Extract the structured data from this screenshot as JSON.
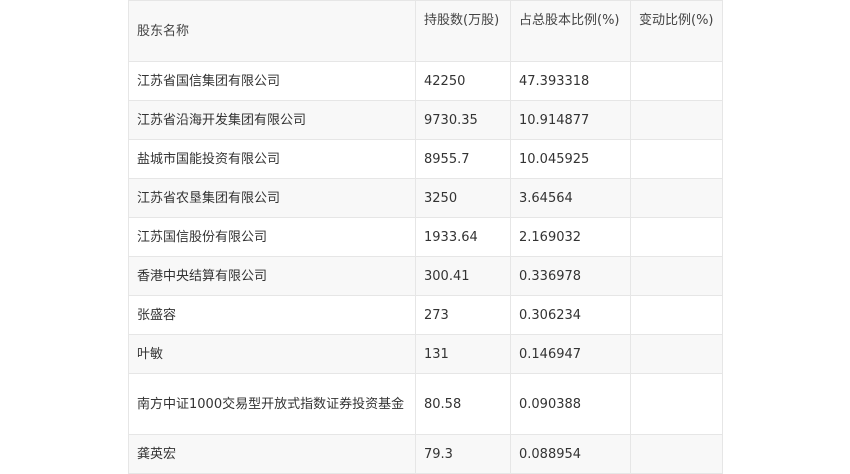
{
  "table": {
    "headers": {
      "name": "股东名称",
      "shares": "持股数(万股)",
      "ratio": "占总股本比例(%)",
      "change": "变动比例(%)"
    },
    "rows": [
      {
        "name": "江苏省国信集团有限公司",
        "shares": "42250",
        "ratio": "47.393318",
        "change": ""
      },
      {
        "name": "江苏省沿海开发集团有限公司",
        "shares": "9730.35",
        "ratio": "10.914877",
        "change": ""
      },
      {
        "name": "盐城市国能投资有限公司",
        "shares": "8955.7",
        "ratio": "10.045925",
        "change": ""
      },
      {
        "name": "江苏省农垦集团有限公司",
        "shares": "3250",
        "ratio": "3.64564",
        "change": ""
      },
      {
        "name": "江苏国信股份有限公司",
        "shares": "1933.64",
        "ratio": "2.169032",
        "change": ""
      },
      {
        "name": "香港中央结算有限公司",
        "shares": "300.41",
        "ratio": "0.336978",
        "change": ""
      },
      {
        "name": "张盛容",
        "shares": "273",
        "ratio": "0.306234",
        "change": ""
      },
      {
        "name": "叶敏",
        "shares": "131",
        "ratio": "0.146947",
        "change": ""
      },
      {
        "name": "南方中证1000交易型开放式指数证券投资基金",
        "shares": "80.58",
        "ratio": "0.090388",
        "change": ""
      },
      {
        "name": "龚英宏",
        "shares": "79.3",
        "ratio": "0.088954",
        "change": ""
      }
    ]
  }
}
